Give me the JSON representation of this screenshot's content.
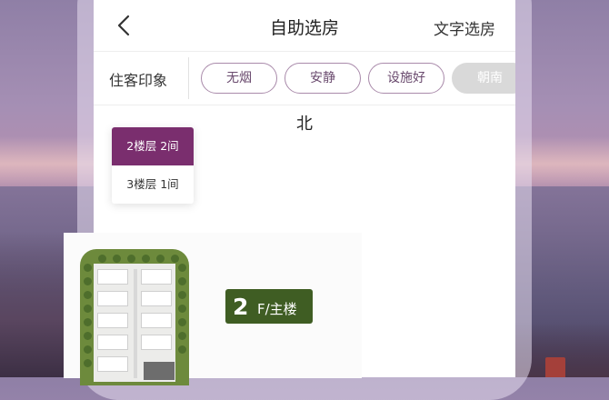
{
  "header": {
    "title": "自助选房",
    "text_select_label": "文字选房"
  },
  "tags": {
    "label": "住客印象",
    "items": [
      {
        "label": "无烟",
        "enabled": true
      },
      {
        "label": "安静",
        "enabled": true
      },
      {
        "label": "设施好",
        "enabled": true
      },
      {
        "label": "朝南",
        "enabled": false
      }
    ]
  },
  "map": {
    "direction_label": "北",
    "floors": [
      {
        "label": "2楼层 2间",
        "selected": true
      },
      {
        "label": "3楼层 1间",
        "selected": false
      }
    ],
    "floor_sign": {
      "number": "2",
      "rest": "F/主楼"
    }
  },
  "colors": {
    "accent": "#7a2e6e",
    "tag_border": "#a98aaa",
    "building_green": "#3f5d23"
  }
}
